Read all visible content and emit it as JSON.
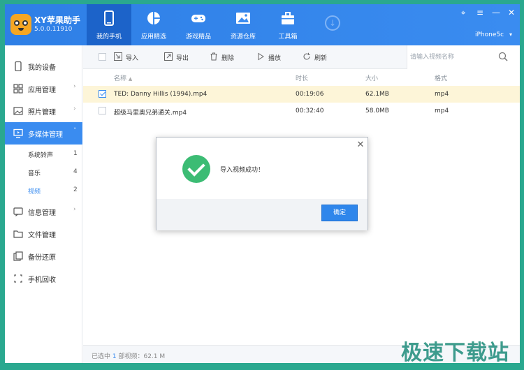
{
  "app": {
    "title": "XY苹果助手",
    "version": "5.0.0.11910",
    "device_name": "iPhone5c"
  },
  "nav": {
    "tabs": [
      {
        "label": "我的手机",
        "icon": "phone-icon"
      },
      {
        "label": "应用精选",
        "icon": "apps-icon"
      },
      {
        "label": "游戏精品",
        "icon": "gamepad-icon"
      },
      {
        "label": "资源仓库",
        "icon": "image-icon"
      },
      {
        "label": "工具箱",
        "icon": "toolbox-icon"
      }
    ]
  },
  "sidebar": {
    "items": [
      {
        "label": "我的设备"
      },
      {
        "label": "应用管理"
      },
      {
        "label": "照片管理"
      },
      {
        "label": "多媒体管理"
      },
      {
        "label": "信息管理"
      },
      {
        "label": "文件管理"
      },
      {
        "label": "备份还原"
      },
      {
        "label": "手机回收"
      }
    ],
    "subitems": [
      {
        "label": "系统铃声",
        "count": "1"
      },
      {
        "label": "音乐",
        "count": "4"
      },
      {
        "label": "视频",
        "count": "2"
      }
    ]
  },
  "toolbar": {
    "import_label": "导入",
    "export_label": "导出",
    "delete_label": "删除",
    "play_label": "播放",
    "refresh_label": "刷新",
    "search_placeholder": "请输入视频名称"
  },
  "table": {
    "columns": {
      "name": "名称",
      "duration": "时长",
      "size": "大小",
      "format": "格式"
    },
    "rows": [
      {
        "name": "TED: Danny Hillis (1994).mp4",
        "duration": "00:19:06",
        "size": "62.1MB",
        "format": "mp4"
      },
      {
        "name": "超级马里奥兄弟通关.mp4",
        "duration": "00:32:40",
        "size": "58.0MB",
        "format": "mp4"
      }
    ]
  },
  "status": {
    "prefix": "已选中 ",
    "count": "1",
    "suffix": " 部视频：62.1 M"
  },
  "dialog": {
    "message": "导入视频成功！",
    "ok_label": "确定"
  },
  "watermark": "极速下载站",
  "colors": {
    "accent": "#3a8cf0",
    "header": "#2e7fe6",
    "success": "#3cbc74",
    "frame": "#2aa88f"
  }
}
